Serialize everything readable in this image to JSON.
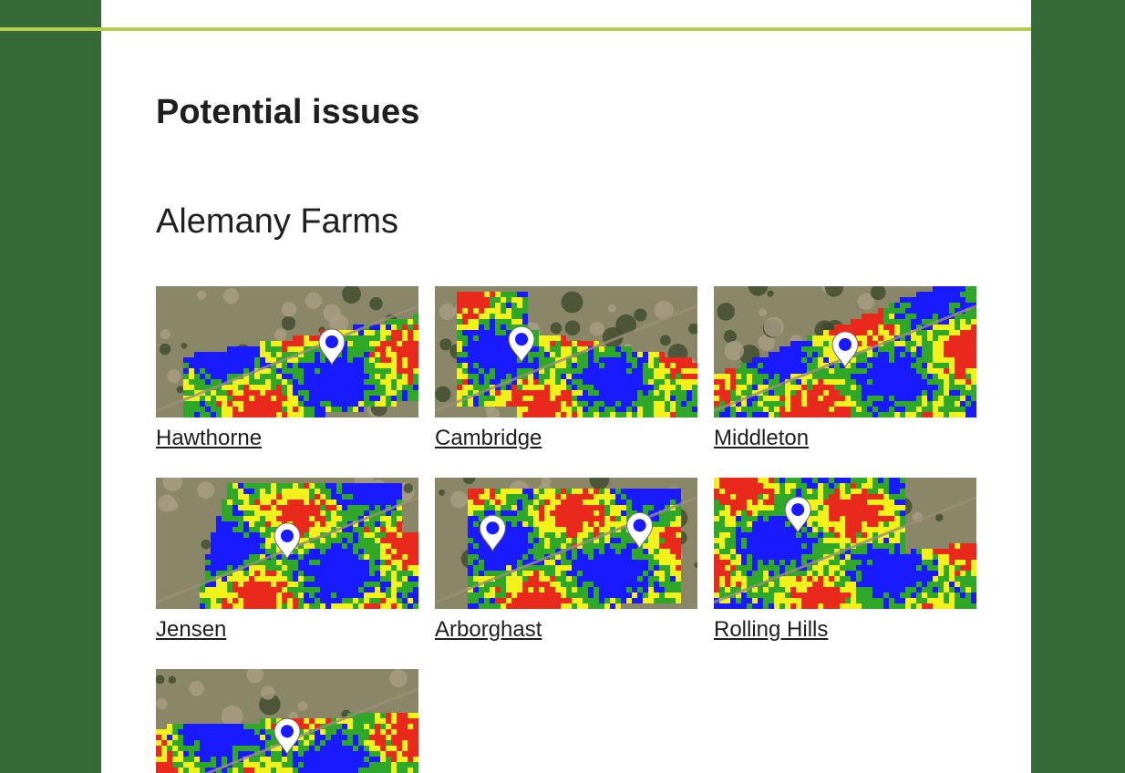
{
  "page": {
    "heading": "Potential issues",
    "farm_name": "Alemany Farms"
  },
  "fields": [
    {
      "name": "Hawthorne",
      "icon": "map-pin-icon"
    },
    {
      "name": "Cambridge",
      "icon": "map-pin-icon"
    },
    {
      "name": "Middleton",
      "icon": "map-pin-icon"
    },
    {
      "name": "Jensen",
      "icon": "map-pin-icon"
    },
    {
      "name": "Arborghast",
      "icon": "map-pin-icon"
    },
    {
      "name": "Rolling Hills",
      "icon": "map-pin-icon"
    },
    {
      "name": "",
      "icon": "map-pin-icon"
    }
  ],
  "colors": {
    "background": "#366a38",
    "accent": "#b4cf4d",
    "heatmap_low": "#1a1aff",
    "heatmap_mid_low": "#2fa82a",
    "heatmap_mid_high": "#f2f21a",
    "heatmap_high": "#e8291c"
  }
}
